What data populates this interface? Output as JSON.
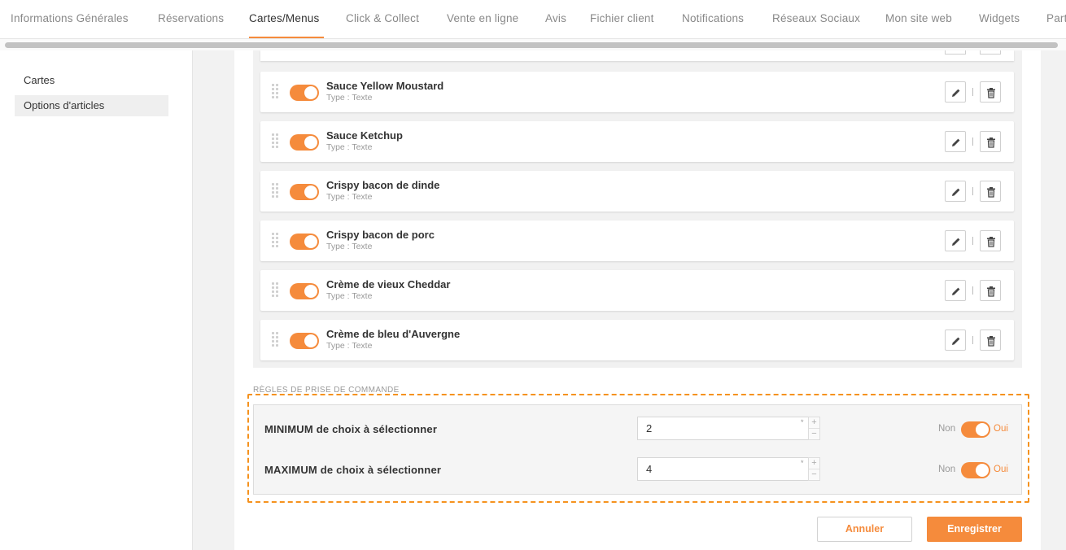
{
  "topnav": {
    "tabs": [
      {
        "label": "Informations Générales"
      },
      {
        "label": "Réservations"
      },
      {
        "label": "Cartes/Menus"
      },
      {
        "label": "Click & Collect"
      },
      {
        "label": "Vente en ligne"
      },
      {
        "label": "Avis"
      },
      {
        "label": "Fichier client"
      },
      {
        "label": "Notifications"
      },
      {
        "label": "Réseaux Sociaux"
      },
      {
        "label": "Mon site web"
      },
      {
        "label": "Widgets"
      },
      {
        "label": "Part"
      }
    ],
    "active_tab": "Cartes/Menus"
  },
  "sidebar": {
    "items": [
      {
        "label": "Cartes"
      },
      {
        "label": "Options d'articles"
      }
    ],
    "selected": "Options d'articles"
  },
  "options": [
    {
      "name": "Sauce Yellow Moustard",
      "type": "Type : Texte",
      "enabled": true
    },
    {
      "name": "Sauce Ketchup",
      "type": "Type : Texte",
      "enabled": true
    },
    {
      "name": "Crispy bacon de dinde",
      "type": "Type : Texte",
      "enabled": true
    },
    {
      "name": "Crispy bacon de porc",
      "type": "Type : Texte",
      "enabled": true
    },
    {
      "name": "Crème de vieux Cheddar",
      "type": "Type : Texte",
      "enabled": true
    },
    {
      "name": "Crème de bleu d'Auvergne",
      "type": "Type : Texte",
      "enabled": true
    }
  ],
  "rules": {
    "section_label": "RÈGLES DE PRISE DE COMMANDE",
    "min": {
      "label": "MINIMUM de choix à sélectionner",
      "value": "2",
      "required_mark": "*",
      "no_label": "Non",
      "yes_label": "Oui",
      "enabled": true
    },
    "max": {
      "label": "MAXIMUM de choix à sélectionner",
      "value": "4",
      "required_mark": "*",
      "no_label": "Non",
      "yes_label": "Oui",
      "enabled": true
    },
    "stepper_up": "+",
    "stepper_down": "−"
  },
  "actions": {
    "cancel_label": "Annuler",
    "save_label": "Enregistrer"
  },
  "colors": {
    "accent": "#f58b3c",
    "highlight_border": "#f5921e"
  }
}
